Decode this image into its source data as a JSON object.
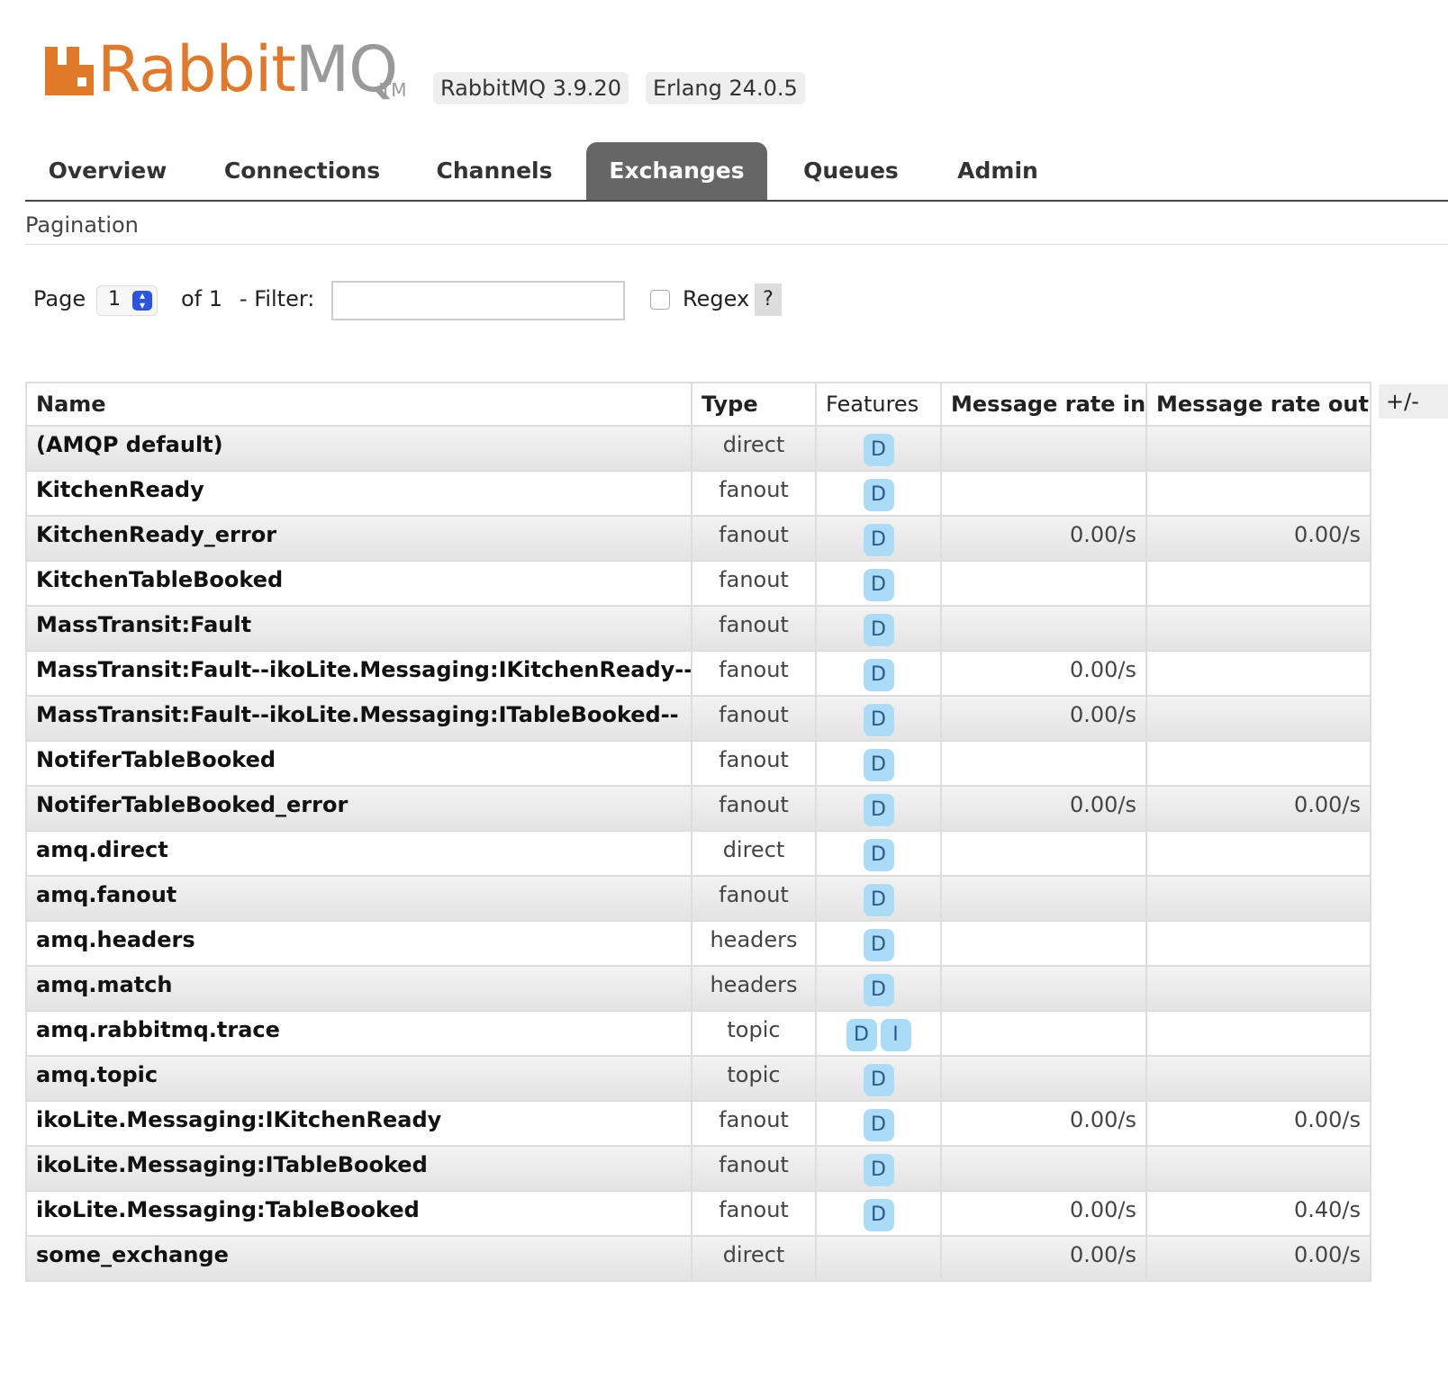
{
  "header": {
    "logo_rabbit": "Rabbit",
    "logo_mq": "MQ",
    "logo_tm": "TM",
    "version": "RabbitMQ 3.9.20",
    "erlang": "Erlang 24.0.5",
    "brand_color": "#e07a2a"
  },
  "nav": {
    "tabs": [
      {
        "label": "Overview"
      },
      {
        "label": "Connections"
      },
      {
        "label": "Channels"
      },
      {
        "label": "Exchanges",
        "active": true
      },
      {
        "label": "Queues"
      },
      {
        "label": "Admin"
      }
    ]
  },
  "pagination": {
    "title": "Pagination",
    "page_label": "Page",
    "page_value": "1",
    "of_label": "of 1",
    "filter_label": "- Filter:",
    "filter_value": "",
    "regex_label": "Regex",
    "help_label": "?"
  },
  "table": {
    "columns": [
      "Name",
      "Type",
      "Features",
      "Message rate in",
      "Message rate out"
    ],
    "plus_minus": "+/-",
    "rows": [
      {
        "name": "(AMQP default)",
        "type": "direct",
        "features": [
          "D"
        ],
        "rate_in": "",
        "rate_out": ""
      },
      {
        "name": "KitchenReady",
        "type": "fanout",
        "features": [
          "D"
        ],
        "rate_in": "",
        "rate_out": ""
      },
      {
        "name": "KitchenReady_error",
        "type": "fanout",
        "features": [
          "D"
        ],
        "rate_in": "0.00/s",
        "rate_out": "0.00/s"
      },
      {
        "name": "KitchenTableBooked",
        "type": "fanout",
        "features": [
          "D"
        ],
        "rate_in": "",
        "rate_out": ""
      },
      {
        "name": "MassTransit:Fault",
        "type": "fanout",
        "features": [
          "D"
        ],
        "rate_in": "",
        "rate_out": ""
      },
      {
        "name": "MassTransit:Fault--ikoLite.Messaging:IKitchenReady--",
        "type": "fanout",
        "features": [
          "D"
        ],
        "rate_in": "0.00/s",
        "rate_out": ""
      },
      {
        "name": "MassTransit:Fault--ikoLite.Messaging:ITableBooked--",
        "type": "fanout",
        "features": [
          "D"
        ],
        "rate_in": "0.00/s",
        "rate_out": ""
      },
      {
        "name": "NotiferTableBooked",
        "type": "fanout",
        "features": [
          "D"
        ],
        "rate_in": "",
        "rate_out": ""
      },
      {
        "name": "NotiferTableBooked_error",
        "type": "fanout",
        "features": [
          "D"
        ],
        "rate_in": "0.00/s",
        "rate_out": "0.00/s"
      },
      {
        "name": "amq.direct",
        "type": "direct",
        "features": [
          "D"
        ],
        "rate_in": "",
        "rate_out": ""
      },
      {
        "name": "amq.fanout",
        "type": "fanout",
        "features": [
          "D"
        ],
        "rate_in": "",
        "rate_out": ""
      },
      {
        "name": "amq.headers",
        "type": "headers",
        "features": [
          "D"
        ],
        "rate_in": "",
        "rate_out": ""
      },
      {
        "name": "amq.match",
        "type": "headers",
        "features": [
          "D"
        ],
        "rate_in": "",
        "rate_out": ""
      },
      {
        "name": "amq.rabbitmq.trace",
        "type": "topic",
        "features": [
          "D",
          "I"
        ],
        "rate_in": "",
        "rate_out": ""
      },
      {
        "name": "amq.topic",
        "type": "topic",
        "features": [
          "D"
        ],
        "rate_in": "",
        "rate_out": ""
      },
      {
        "name": "ikoLite.Messaging:IKitchenReady",
        "type": "fanout",
        "features": [
          "D"
        ],
        "rate_in": "0.00/s",
        "rate_out": "0.00/s"
      },
      {
        "name": "ikoLite.Messaging:ITableBooked",
        "type": "fanout",
        "features": [
          "D"
        ],
        "rate_in": "",
        "rate_out": ""
      },
      {
        "name": "ikoLite.Messaging:TableBooked",
        "type": "fanout",
        "features": [
          "D"
        ],
        "rate_in": "0.00/s",
        "rate_out": "0.40/s"
      },
      {
        "name": "some_exchange",
        "type": "direct",
        "features": [],
        "rate_in": "0.00/s",
        "rate_out": "0.00/s"
      }
    ]
  }
}
